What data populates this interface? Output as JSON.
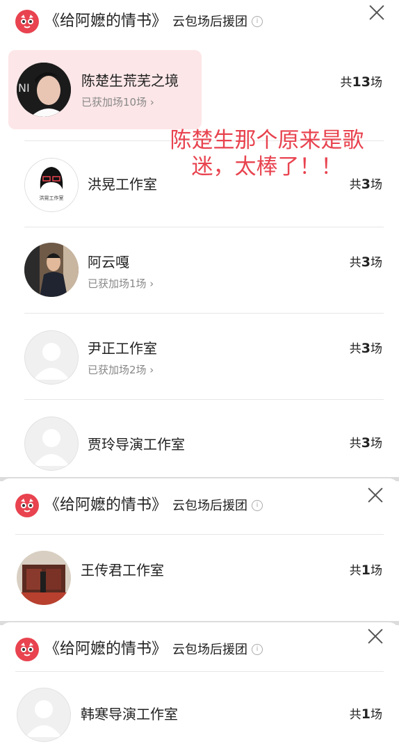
{
  "colors": {
    "accent": "#e8434f",
    "highlight_bg": "#fde6e8",
    "divider": "#e6e6e6",
    "muted": "#888888"
  },
  "panels": [
    {
      "title": "《给阿嬷的情书》",
      "subtitle": "云包场后援团",
      "rows": [
        {
          "name": "陈楚生荒芜之境",
          "extra": "已获加场10场 ›",
          "count_prefix": "共",
          "count": "13",
          "count_suffix": "场",
          "avatar": "photo-singer",
          "highlighted": true
        },
        {
          "name": "洪晃工作室",
          "extra": "",
          "count_prefix": "共",
          "count": "3",
          "count_suffix": "场",
          "avatar": "studio-logo"
        },
        {
          "name": "阿云嘎",
          "extra": "已获加场1场 ›",
          "count_prefix": "共",
          "count": "3",
          "count_suffix": "场",
          "avatar": "photo-performer"
        },
        {
          "name": "尹正工作室",
          "extra": "已获加场2场 ›",
          "count_prefix": "共",
          "count": "3",
          "count_suffix": "场",
          "avatar": "default-avatar"
        },
        {
          "name": "贾玲导演工作室",
          "extra": "",
          "count_prefix": "共",
          "count": "3",
          "count_suffix": "场",
          "avatar": "default-avatar"
        }
      ],
      "avatar_caption": "洪晃工作室"
    },
    {
      "title": "《给阿嬷的情书》",
      "subtitle": "云包场后援团",
      "rows": [
        {
          "name": "王传君工作室",
          "extra": "",
          "count_prefix": "共",
          "count": "1",
          "count_suffix": "场",
          "avatar": "photo-stage"
        }
      ]
    },
    {
      "title": "《给阿嬷的情书》",
      "subtitle": "云包场后援团",
      "rows": [
        {
          "name": "韩寒导演工作室",
          "extra": "",
          "count_prefix": "共",
          "count": "1",
          "count_suffix": "场",
          "avatar": "default-avatar"
        }
      ]
    }
  ],
  "comment": {
    "line1": "陈楚生那个原来是歌",
    "line2": "迷，太棒了！！"
  }
}
